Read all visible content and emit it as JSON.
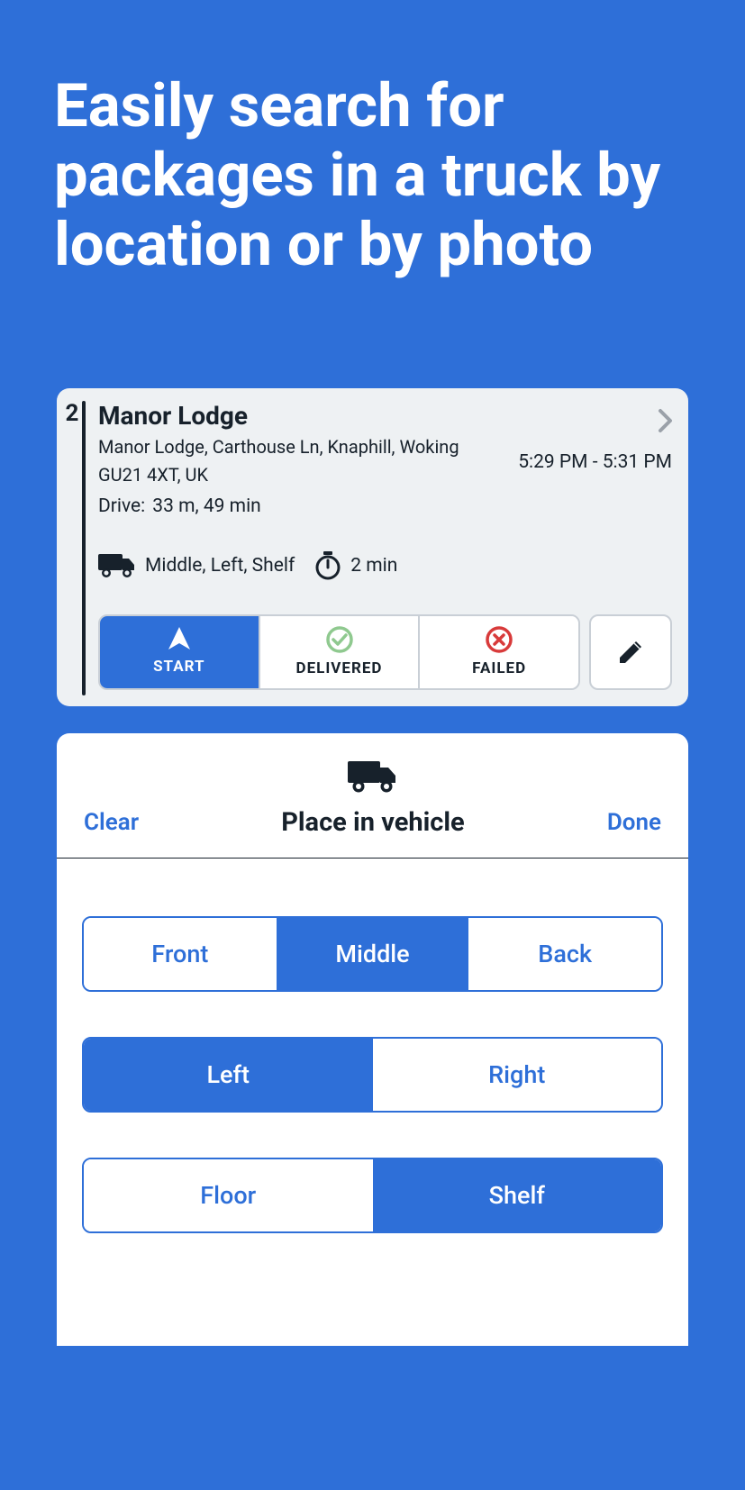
{
  "hero": {
    "text": "Easily search for packages in a truck by location or by photo"
  },
  "stop": {
    "number": "2",
    "title": "Manor Lodge",
    "address_line1": "Manor Lodge, Carthouse Ln, Knaphill, Woking",
    "address_line2": "GU21 4XT, UK",
    "time_window": "5:29 PM - 5:31 PM",
    "drive_label": "Drive:",
    "drive_value": "33 m, 49 min",
    "location": "Middle, Left, Shelf",
    "duration": "2 min"
  },
  "actions": {
    "start": "START",
    "delivered": "DELIVERED",
    "failed": "FAILED"
  },
  "panel": {
    "clear": "Clear",
    "title": "Place in vehicle",
    "done": "Done",
    "row1": {
      "front": "Front",
      "middle": "Middle",
      "back": "Back"
    },
    "row2": {
      "left": "Left",
      "right": "Right"
    },
    "row3": {
      "floor": "Floor",
      "shelf": "Shelf"
    }
  }
}
